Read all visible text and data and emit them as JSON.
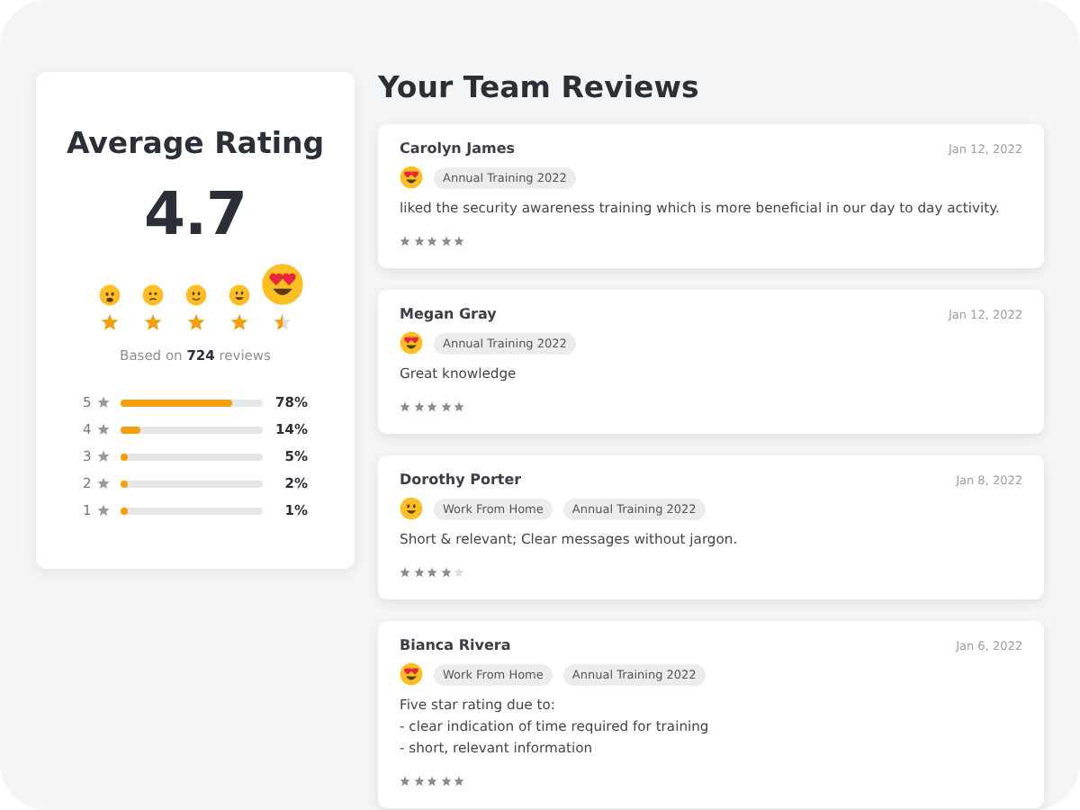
{
  "summary": {
    "title": "Average Rating",
    "score": "4.7",
    "faces": [
      {
        "kind": "worried",
        "selected": false
      },
      {
        "kind": "confused",
        "selected": false
      },
      {
        "kind": "smile",
        "selected": false
      },
      {
        "kind": "grin",
        "selected": false
      },
      {
        "kind": "love",
        "selected": true
      }
    ],
    "stars": 4.5,
    "based_on": "Based on **724** reviews",
    "breakdown": [
      {
        "label": "5",
        "level": 0.78,
        "percent": "78%"
      },
      {
        "label": "4",
        "level": 0.14,
        "percent": "14%"
      },
      {
        "label": "3",
        "level": 0.05,
        "percent": "5%"
      },
      {
        "label": "2",
        "level": 0.02,
        "percent": "2%"
      },
      {
        "label": "1",
        "level": 0.01,
        "percent": "1%"
      }
    ]
  },
  "reviews_title": "Your Team Reviews",
  "reviews": [
    {
      "name": "Carolyn James",
      "date": "Jan 12, 2022",
      "kind": "love",
      "tags": [
        "Annual Training 2022"
      ],
      "text": "liked the security awareness training which is more beneficial in our day to day activity.",
      "stars": 5
    },
    {
      "name": "Megan Gray",
      "date": "Jan 12, 2022",
      "kind": "love",
      "tags": [
        "Annual Training 2022"
      ],
      "text": "Great knowledge",
      "stars": 5
    },
    {
      "name": "Dorothy Porter",
      "date": "Jan 8, 2022",
      "kind": "grin",
      "tags": [
        "Work From Home",
        "Annual Training 2022"
      ],
      "text": "Short & relevant; Clear messages without jargon.",
      "stars": 4
    },
    {
      "name": "Bianca Rivera",
      "date": "Jan 6, 2022",
      "kind": "love",
      "tags": [
        "Work From Home",
        "Annual Training 2022"
      ],
      "text": "Five star rating due to:\n- clear indication of time required for training\n- short, relevant information",
      "stars": 5
    }
  ]
}
